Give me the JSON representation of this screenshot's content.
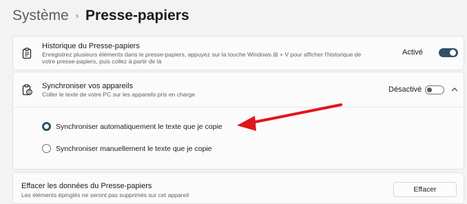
{
  "breadcrumb": {
    "parent": "Système",
    "separator": "›",
    "current": "Presse-papiers"
  },
  "history": {
    "title": "Historique du Presse-papiers",
    "desc_line1": "Enregistrez plusieurs éléments dans le presse-papiers, appuyez sur la touche Windows ⊞ + V pour afficher l'historique de",
    "desc_line2": "votre presse-papiers, puis collez à partir de là",
    "status": "Activé",
    "toggle_on": true
  },
  "sync": {
    "title": "Synchroniser vos appareils",
    "desc": "Coller le texte de votre PC sur les appareils pris en charge",
    "status": "Désactivé",
    "toggle_on": false,
    "options": [
      {
        "label": "Synchroniser automatiquement le texte que je copie",
        "checked": true
      },
      {
        "label": "Synchroniser manuellement le texte que je copie",
        "checked": false
      }
    ]
  },
  "clear": {
    "title": "Effacer les données du Presse-papiers",
    "desc": "Les éléments épinglés ne seront pas supprimés sur cet appareil",
    "button_label": "Effacer"
  },
  "colors": {
    "accent": "#2f5166",
    "arrow": "#e0161b"
  }
}
